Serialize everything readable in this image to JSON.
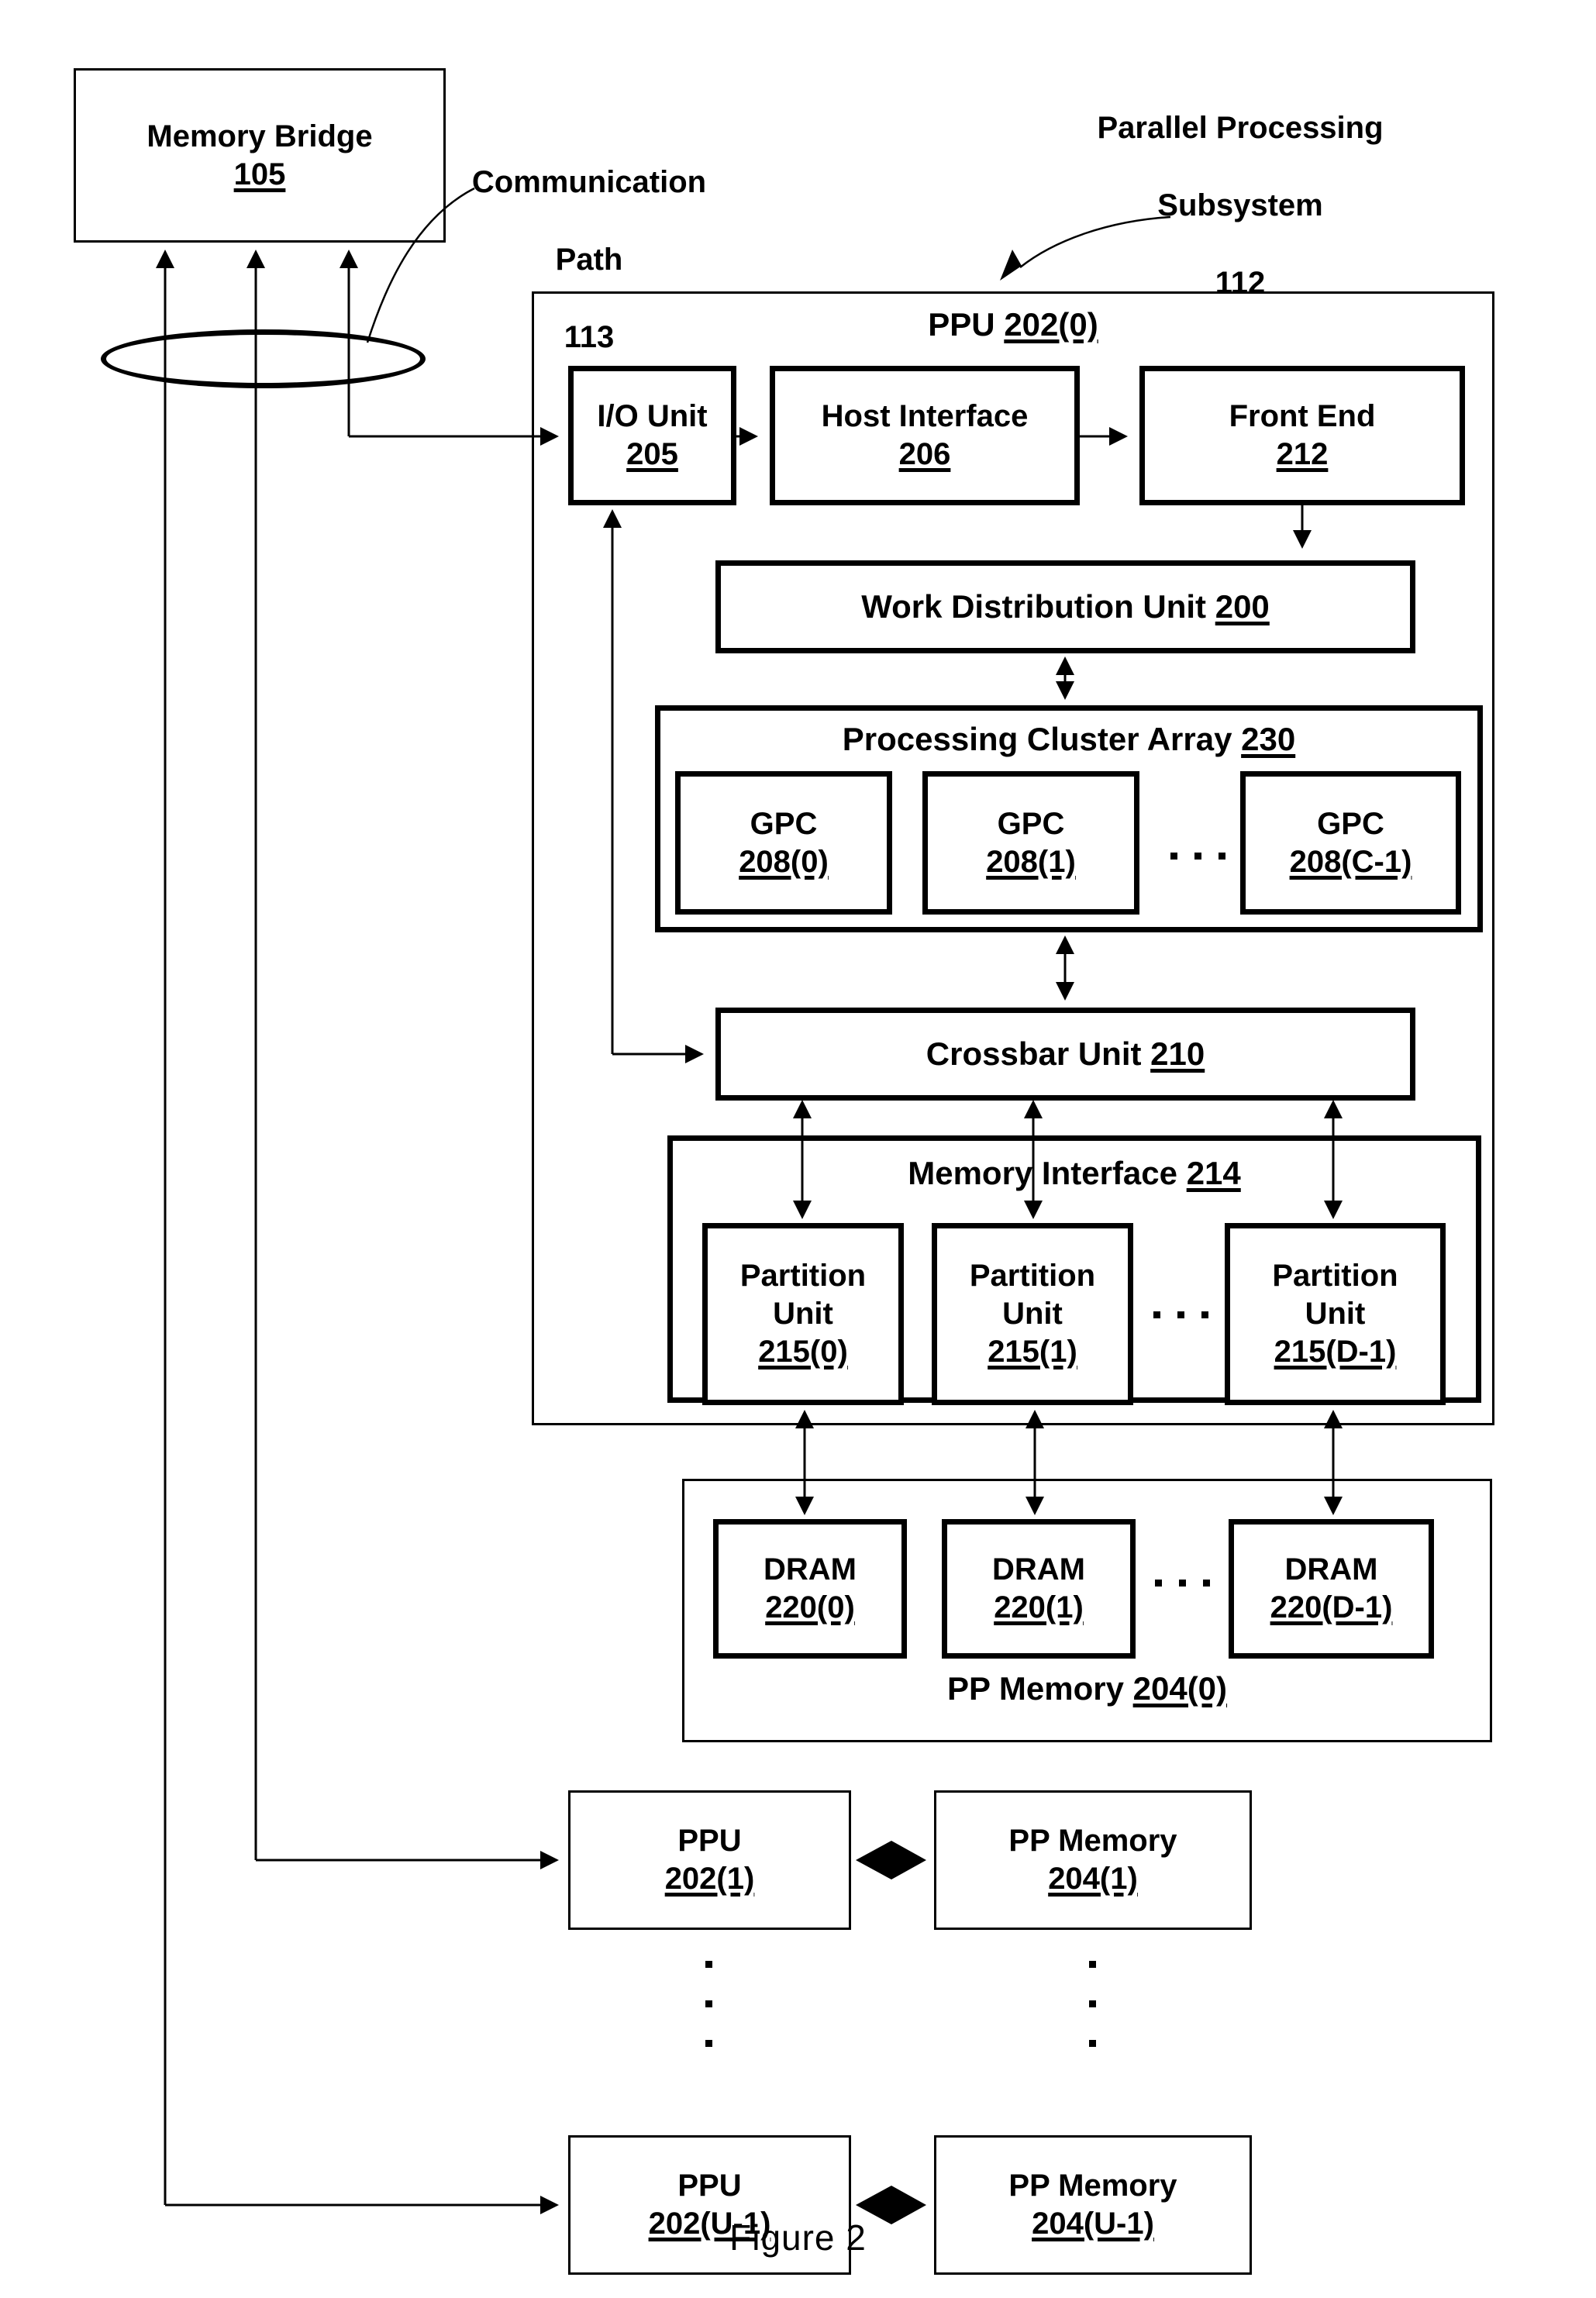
{
  "figure": {
    "caption": "Figure 2"
  },
  "annotations": {
    "communication_path": {
      "line1": "Communication",
      "line2": "Path",
      "line3": "113"
    },
    "subsystem": {
      "line1": "Parallel Processing",
      "line2": "Subsystem",
      "line3": "112"
    }
  },
  "memory_bridge": {
    "name": "Memory Bridge",
    "ref": "105"
  },
  "ppu0": {
    "title_text": "PPU ",
    "title_ref": "202(0)",
    "io_unit": {
      "name": "I/O Unit",
      "ref": "205"
    },
    "host_interface": {
      "name": "Host Interface",
      "ref": "206"
    },
    "front_end": {
      "name": "Front End",
      "ref": "212"
    },
    "work_distribution_unit": {
      "name": "Work Distribution Unit ",
      "ref": "200"
    },
    "processing_cluster_array": {
      "name": "Processing Cluster Array ",
      "ref": "230",
      "gpcs": [
        {
          "name": "GPC",
          "ref": "208(0)"
        },
        {
          "name": "GPC",
          "ref": "208(1)"
        },
        {
          "name": "GPC",
          "ref": "208(C-1)"
        }
      ],
      "ellipsis": "..."
    },
    "crossbar_unit": {
      "name": "Crossbar Unit ",
      "ref": "210"
    },
    "memory_interface": {
      "name": "Memory Interface ",
      "ref": "214",
      "partition_units": [
        {
          "line1": "Partition",
          "line2": "Unit",
          "ref": "215(0)"
        },
        {
          "line1": "Partition",
          "line2": "Unit",
          "ref": "215(1)"
        },
        {
          "line1": "Partition",
          "line2": "Unit",
          "ref": "215(D-1)"
        }
      ],
      "ellipsis": "..."
    }
  },
  "pp_memory0": {
    "name": "PP Memory ",
    "ref": "204(0)",
    "drams": [
      {
        "name": "DRAM",
        "ref": "220(0)"
      },
      {
        "name": "DRAM",
        "ref": "220(1)"
      },
      {
        "name": "DRAM",
        "ref": "220(D-1)"
      }
    ],
    "ellipsis": "..."
  },
  "additional_units": [
    {
      "ppu": {
        "name": "PPU",
        "ref": "202(1)"
      },
      "memory": {
        "name": "PP Memory",
        "ref": "204(1)"
      }
    },
    {
      "ppu": {
        "name": "PPU",
        "ref": "202(U-1)"
      },
      "memory": {
        "name": "PP Memory",
        "ref": "204(U-1)"
      }
    }
  ],
  "vertical_ellipsis": "⋮",
  "colors": {
    "stroke": "#000000",
    "background": "#ffffff"
  }
}
